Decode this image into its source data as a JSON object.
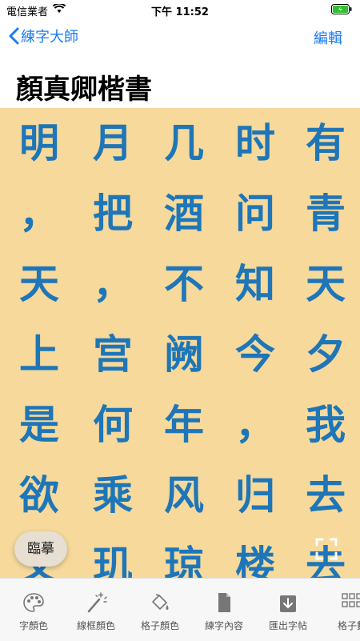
{
  "status": {
    "carrier": "電信業者",
    "time": "下午 11:52"
  },
  "nav": {
    "back_label": "練字大師",
    "edit_label": "編輯"
  },
  "page_title": "顏真卿楷書",
  "grid": {
    "columns": [
      [
        "有",
        "青",
        "天",
        "夕",
        "我",
        "去",
        "去"
      ],
      [
        "时",
        "问",
        "知",
        "今",
        "，",
        "归",
        "楼"
      ],
      [
        "几",
        "酒",
        "不",
        "阙",
        "年",
        "风",
        "琼"
      ],
      [
        "月",
        "把",
        "，",
        "宫",
        "何",
        "乘",
        "玑"
      ],
      [
        "明",
        "，",
        "天",
        "上",
        "是",
        "欲",
        "又"
      ]
    ]
  },
  "trace_button": {
    "label": "臨摹"
  },
  "toolbar": {
    "items": [
      {
        "label": "字顏色",
        "icon": "palette-icon"
      },
      {
        "label": "線框顏色",
        "icon": "magic-wand-icon"
      },
      {
        "label": "格子顏色",
        "icon": "paint-bucket-icon"
      },
      {
        "label": "練字內容",
        "icon": "document-icon"
      },
      {
        "label": "匯出字帖",
        "icon": "export-icon"
      },
      {
        "label": "格子數",
        "icon": "grid-icon"
      }
    ]
  },
  "colors": {
    "accent": "#1a7cf5",
    "grid_bg": "#f6d99b",
    "char": "#1e76b8"
  }
}
